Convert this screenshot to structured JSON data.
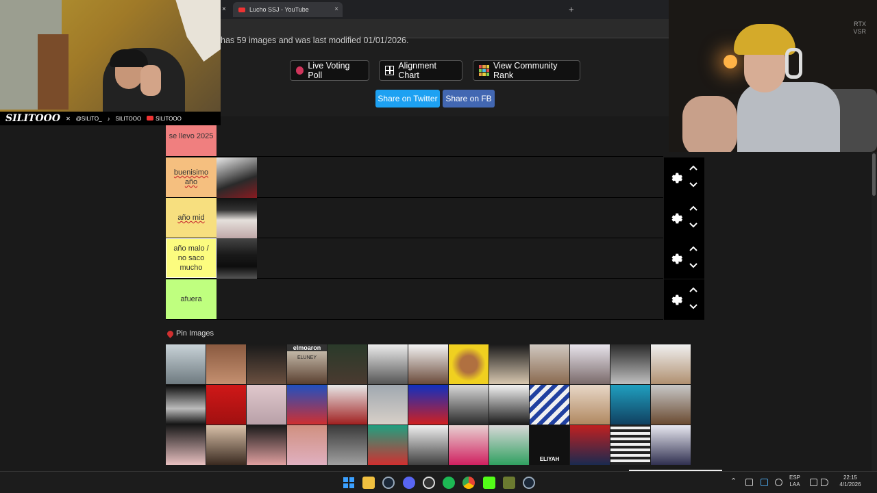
{
  "browser": {
    "tab_title": "Lucho SSJ - YouTube",
    "tab_close": "×",
    "new_tab": "+",
    "window_close": "×"
  },
  "page": {
    "description": "has 59 images and was last modified 01/01/2026.",
    "buttons": {
      "live_voting": "Live Voting Poll",
      "alignment": "Alignment Chart",
      "community_rank": "View Community Rank"
    },
    "share": {
      "twitter": "Share on Twitter",
      "fb": "Share on FB"
    },
    "colors": {
      "twitter": "#1da1f2",
      "fb": "#4267b2",
      "live_dot": "#d0355b"
    }
  },
  "tiers": [
    {
      "label": "se llevo 2025",
      "color": "#f07f7f",
      "items": 0
    },
    {
      "label": "buenisimo año",
      "color": "#f5bf7f",
      "items": 1
    },
    {
      "label": "año mid",
      "color": "#f7df7f",
      "items": 1
    },
    {
      "label": "año malo / no saco mucho",
      "color": "#fcfc7f",
      "items": 1
    },
    {
      "label": "afuera",
      "color": "#bfff7f",
      "items": 0
    }
  ],
  "pin_images": {
    "label": "Pin Images",
    "title_top": "elmoaron",
    "title_mid": "ELUNEY",
    "bottom_text": "ELIYAH"
  },
  "overlay": {
    "brand": "SILITOOO",
    "x_handle": "@SILITO_",
    "tiktok_handle": "SILITOOO",
    "yt_handle": "SILITOOO",
    "rtx_line1": "RTX",
    "rtx_line2": "VSR"
  },
  "taskbar": {
    "lang_line1": "ESP",
    "lang_line2": "LAA",
    "time": "22:15",
    "date": "4/1/2026"
  }
}
